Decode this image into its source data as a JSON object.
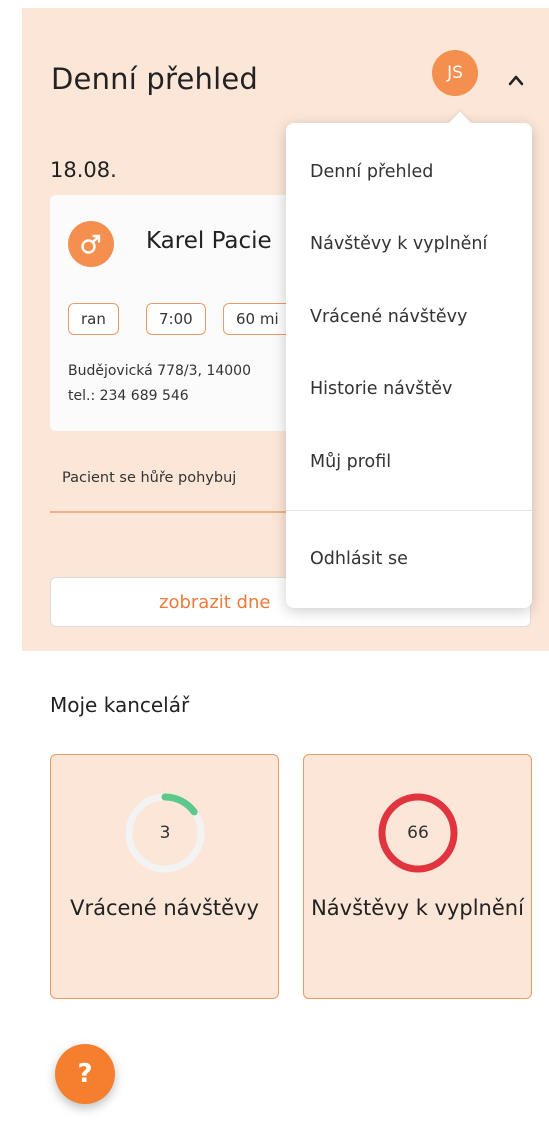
{
  "header": {
    "title": "Denní přehled",
    "avatar_initials": "JS",
    "menu_toggle_icon": "chevron-up-icon"
  },
  "daily": {
    "date": "18.08.",
    "visit": {
      "gender_icon": "male-icon",
      "patient_name": "Karel Pacie",
      "tags": [
        "ran",
        "7:00",
        "60 mi"
      ],
      "address": "Budějovická 778/3, 14000",
      "phone": "tel.: 234 689 546",
      "note": "Pacient se hůře pohybuj"
    },
    "show_day_button": "zobrazit dne"
  },
  "user_menu": {
    "items": [
      "Denní přehled",
      "Návštěvy k vyplnění",
      "Vrácené návštěvy",
      "Historie návštěv",
      "Můj profil"
    ],
    "logout": "Odhlásit se"
  },
  "office": {
    "title": "Moje kancelář",
    "cards": [
      {
        "value": "3",
        "label": "Vrácené návštěvy",
        "ring_color": "#5cc98a",
        "ring_fraction": 0.15
      },
      {
        "value": "66",
        "label": "Návštěvy k vyplnění",
        "ring_color": "#e0353f",
        "ring_fraction": 1.0
      }
    ]
  },
  "help_button": "?",
  "colors": {
    "accent": "#f48f4f",
    "panel": "#fce6d8",
    "action_text": "#f07a3a"
  }
}
